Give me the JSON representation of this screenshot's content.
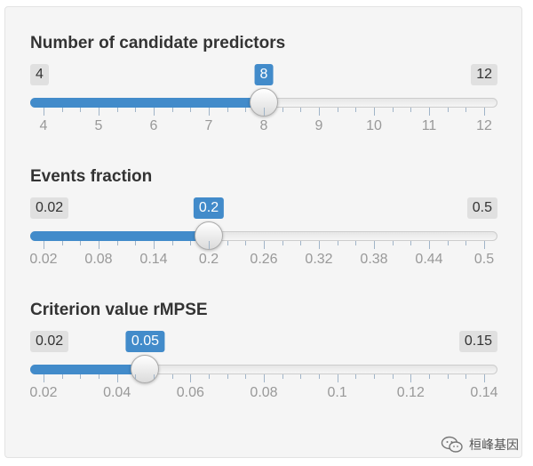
{
  "sliders": [
    {
      "label": "Number of candidate predictors",
      "min_label": "4",
      "max_label": "12",
      "value_label": "8",
      "min": 4,
      "max": 12,
      "value": 8,
      "major_ticks": [
        "4",
        "5",
        "6",
        "7",
        "8",
        "9",
        "10",
        "11",
        "12"
      ],
      "minor_per_major": 2,
      "accent": "#428bca"
    },
    {
      "label": "Events fraction",
      "min_label": "0.02",
      "max_label": "0.5",
      "value_label": "0.2",
      "min": 0.02,
      "max": 0.5,
      "value": 0.2,
      "major_ticks": [
        "0.02",
        "0.08",
        "0.14",
        "0.2",
        "0.26",
        "0.32",
        "0.38",
        "0.44",
        "0.5"
      ],
      "minor_per_major": 2,
      "accent": "#428bca"
    },
    {
      "label": "Criterion value rMPSE",
      "min_label": "0.02",
      "max_label": "0.15",
      "value_label": "0.05",
      "min": 0.02,
      "max": 0.15,
      "value": 0.05,
      "major_ticks": [
        "0.02",
        "0.04",
        "0.06",
        "0.08",
        "0.1",
        "0.12",
        "0.14"
      ],
      "minor_per_major": 3,
      "accent": "#428bca"
    }
  ],
  "watermark": {
    "text": "桓峰基因",
    "icon": "wechat-icon"
  }
}
